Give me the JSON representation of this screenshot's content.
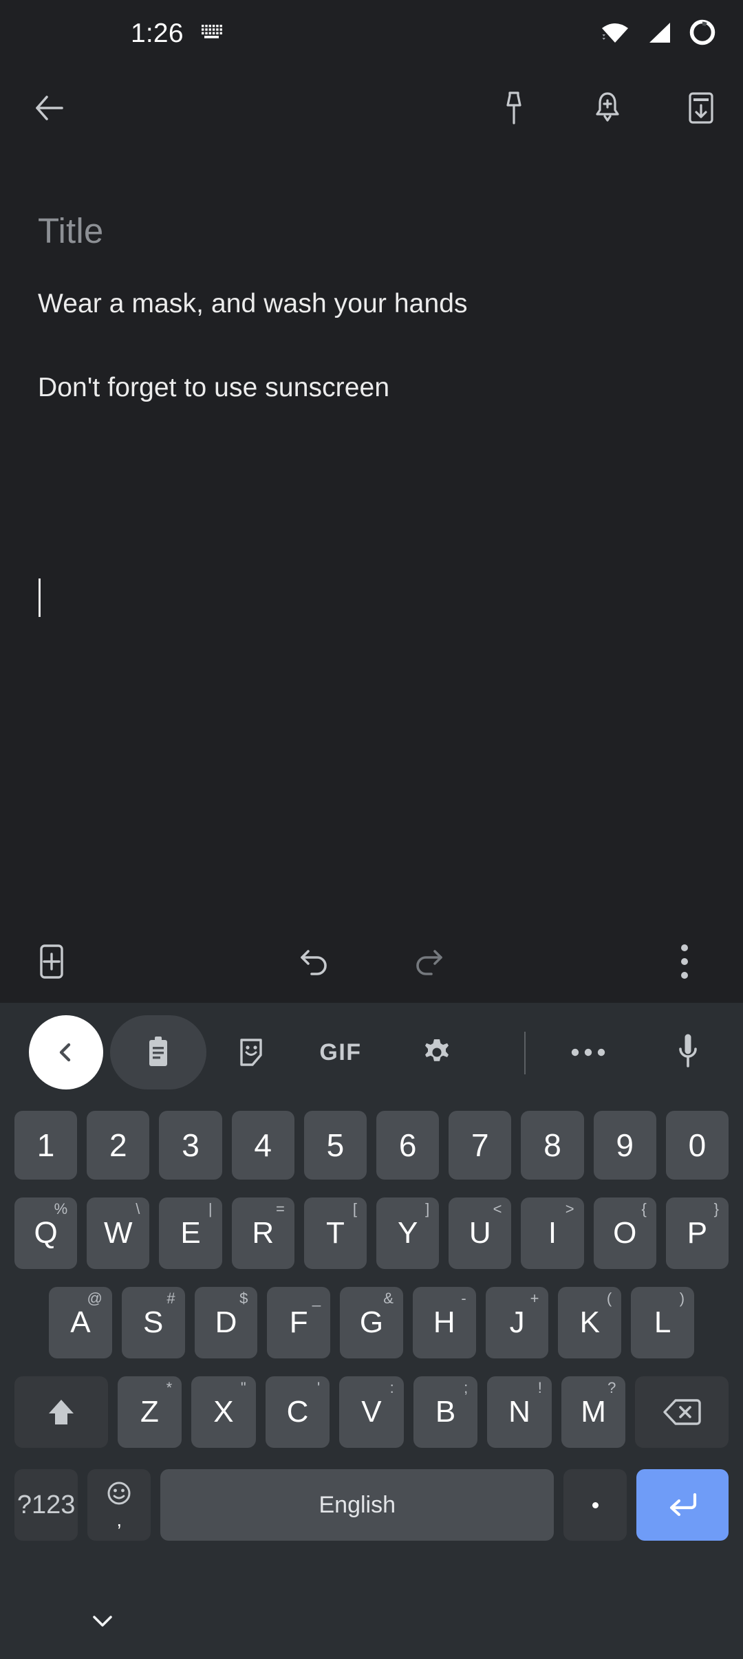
{
  "status_bar": {
    "time": "1:26",
    "icons": [
      "keyboard-indicator-icon",
      "wifi-icon",
      "cellular-signal-icon",
      "battery-ring-icon"
    ]
  },
  "app_bar": {
    "back_label": "Back",
    "actions": [
      {
        "name": "pin-icon",
        "label": "Pin note"
      },
      {
        "name": "reminder-bell-icon",
        "label": "Add reminder"
      },
      {
        "name": "archive-icon",
        "label": "Archive"
      }
    ]
  },
  "note": {
    "title_placeholder": "Title",
    "title_value": "",
    "body_text": "Wear a mask, and wash your hands\n\nDon't forget to use sunscreen\n",
    "caret_visible": true
  },
  "note_toolbar": {
    "add_label": "Add",
    "undo_label": "Undo",
    "redo_label": "Redo",
    "more_label": "More options",
    "undo_enabled": true,
    "redo_enabled": false
  },
  "keyboard": {
    "toolbar": [
      {
        "name": "toolbar-back-chevron",
        "label": "Back"
      },
      {
        "name": "clipboard-icon",
        "label": "Clipboard"
      },
      {
        "name": "sticker-icon",
        "label": "Stickers"
      },
      {
        "name": "gif-label",
        "label": "GIF"
      },
      {
        "name": "gear-icon",
        "label": "Settings"
      },
      {
        "name": "overflow-dots-icon",
        "label": "More"
      },
      {
        "name": "microphone-icon",
        "label": "Voice input"
      }
    ],
    "rows": {
      "numbers": [
        {
          "key": "1"
        },
        {
          "key": "2"
        },
        {
          "key": "3"
        },
        {
          "key": "4"
        },
        {
          "key": "5"
        },
        {
          "key": "6"
        },
        {
          "key": "7"
        },
        {
          "key": "8"
        },
        {
          "key": "9"
        },
        {
          "key": "0"
        }
      ],
      "top": [
        {
          "key": "Q",
          "hint": "%"
        },
        {
          "key": "W",
          "hint": "\\"
        },
        {
          "key": "E",
          "hint": "|"
        },
        {
          "key": "R",
          "hint": "="
        },
        {
          "key": "T",
          "hint": "["
        },
        {
          "key": "Y",
          "hint": "]"
        },
        {
          "key": "U",
          "hint": "<"
        },
        {
          "key": "I",
          "hint": ">"
        },
        {
          "key": "O",
          "hint": "{"
        },
        {
          "key": "P",
          "hint": "}"
        }
      ],
      "home": [
        {
          "key": "A",
          "hint": "@"
        },
        {
          "key": "S",
          "hint": "#"
        },
        {
          "key": "D",
          "hint": "$"
        },
        {
          "key": "F",
          "hint": "_"
        },
        {
          "key": "G",
          "hint": "&"
        },
        {
          "key": "H",
          "hint": "-"
        },
        {
          "key": "J",
          "hint": "+"
        },
        {
          "key": "K",
          "hint": "("
        },
        {
          "key": "L",
          "hint": ")"
        }
      ],
      "bottom": [
        {
          "key": "Z",
          "hint": "*"
        },
        {
          "key": "X",
          "hint": "\""
        },
        {
          "key": "C",
          "hint": "'"
        },
        {
          "key": "V",
          "hint": ":"
        },
        {
          "key": "B",
          "hint": ";"
        },
        {
          "key": "N",
          "hint": "!"
        },
        {
          "key": "M",
          "hint": "?"
        }
      ],
      "space_row": {
        "symbols_key": "?123",
        "emoji_sub_key": ",",
        "space_label": "English",
        "period_key": ".",
        "enter_label": "Enter"
      }
    },
    "shift_label": "Shift",
    "backspace_label": "Backspace"
  },
  "nav_bar": {
    "hide_keyboard_label": "Hide keyboard"
  },
  "colors": {
    "app_background": "#1f2023",
    "keyboard_background": "#2b2f33",
    "key_background": "#4a4e53",
    "modifier_key_background": "#36393d",
    "enter_key_accent": "#6f9cf7",
    "primary_text": "#ececec",
    "placeholder_text": "#8d9095"
  }
}
